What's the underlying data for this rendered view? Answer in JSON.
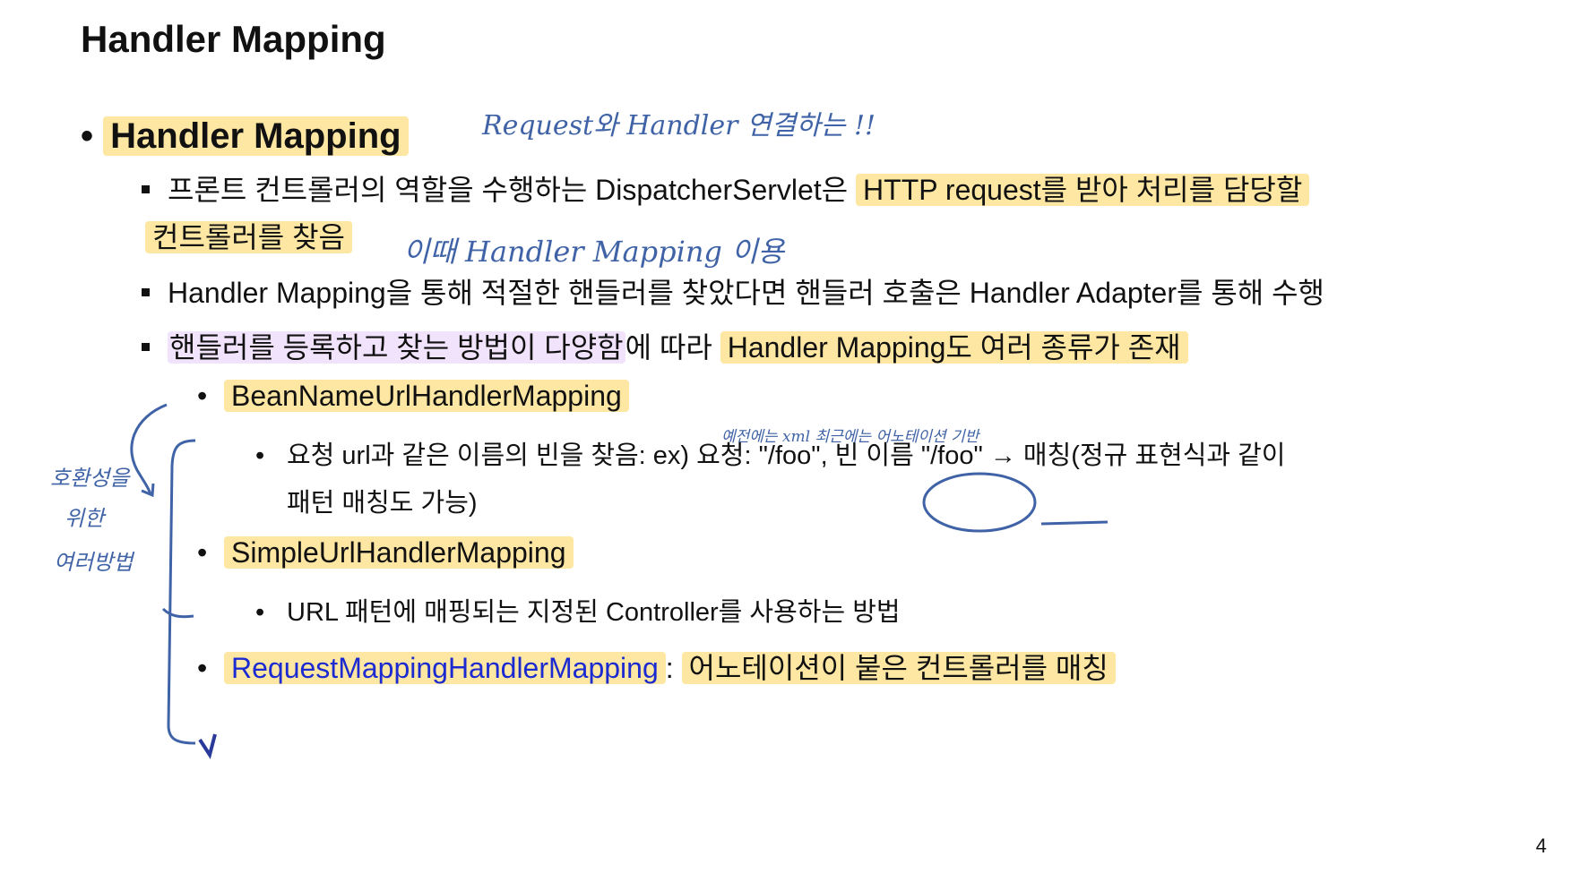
{
  "slide": {
    "title": "Handler Mapping",
    "main_bullet": "Handler Mapping",
    "page_number": "4"
  },
  "bullets": [
    {
      "plain": "프론트 컨트롤러의 역할을 수행하는 DispatcherServlet은 ",
      "hl_a": "HTTP request를 받아 처리를 담당할",
      "hl_b": "컨트롤러를 찾음"
    },
    {
      "text": "Handler Mapping을 통해 적절한 핸들러를 찾았다면 핸들러 호출은 Handler Adapter를 통해 수행"
    },
    {
      "hl_purple": "핸들러를 등록하고 찾는 방법이 다양함",
      "plain": "에 따라 ",
      "hl_yellow": "Handler Mapping도 여러 종류가 존재"
    }
  ],
  "mappings": [
    {
      "name": "BeanNameUrlHandlerMapping",
      "detail": "요청 url과 같은 이름의 빈을 찾음: ex) 요청: \"/foo\", 빈 이름 \"/foo\" → 매칭(정규 표현식과 같이",
      "detail_cont": "패턴 매칭도 가능)"
    },
    {
      "name": "SimpleUrlHandlerMapping",
      "detail": "URL 패턴에 매핑되는 지정된 Controller를 사용하는 방법"
    },
    {
      "name": "RequestMappingHandlerMapping",
      "sep": ":",
      "desc": "어노테이션이 붙은 컨트롤러를 매칭"
    }
  ],
  "handwriting": {
    "note_title": "Request와 Handler 연결하는 !!",
    "note_line": "이때 Handler Mapping 이용",
    "note_mid": "예전에는 xml 최근에는 어노테이션 기반",
    "side_1": "호환성을",
    "side_2": "위한",
    "side_3": "여러방법"
  },
  "colors": {
    "highlight_yellow": "#fde7a3",
    "highlight_purple": "#f1e3fb",
    "ink_blue": "#3f63a6",
    "link_blue": "#1c2bd1"
  }
}
